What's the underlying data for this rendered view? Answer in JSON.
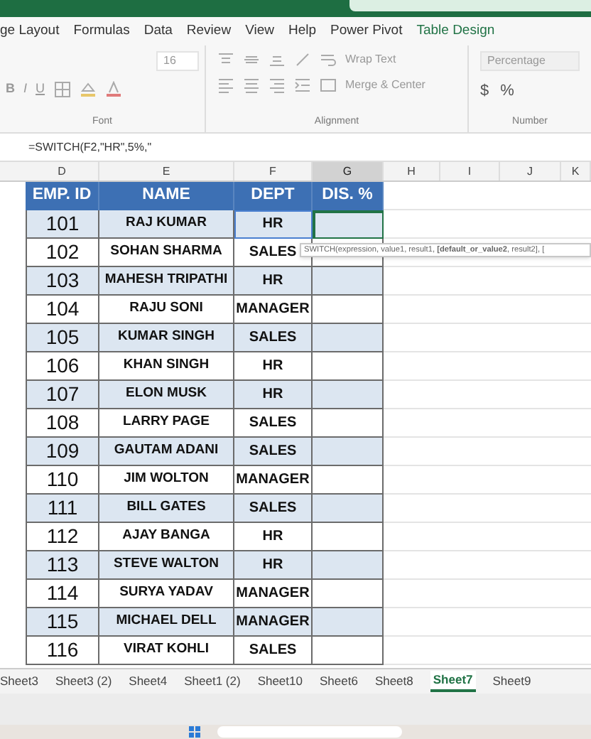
{
  "menu_tabs": [
    {
      "label": "ge Layout",
      "kind": "normal"
    },
    {
      "label": "Formulas",
      "kind": "normal"
    },
    {
      "label": "Data",
      "kind": "normal"
    },
    {
      "label": "Review",
      "kind": "normal"
    },
    {
      "label": "View",
      "kind": "normal"
    },
    {
      "label": "Help",
      "kind": "normal"
    },
    {
      "label": "Power Pivot",
      "kind": "normal"
    },
    {
      "label": "Table Design",
      "kind": "contextual"
    }
  ],
  "ribbon": {
    "font_size": "16",
    "wrap_text": "Wrap Text",
    "merge": "Merge & Center",
    "number_format": "Percentage",
    "currency": "$",
    "percent": "%",
    "bold": "B",
    "italic": "I",
    "underline": "U",
    "groups": [
      "Font",
      "Alignment",
      "Number"
    ]
  },
  "formula": "=SWITCH(F2,\"HR\",5%,\"",
  "columns": [
    {
      "label": "D",
      "selected": false
    },
    {
      "label": "E",
      "selected": false
    },
    {
      "label": "F",
      "selected": false
    },
    {
      "label": "G",
      "selected": true
    },
    {
      "label": "H",
      "selected": false
    },
    {
      "label": "I",
      "selected": false
    },
    {
      "label": "J",
      "selected": false
    },
    {
      "label": "K",
      "selected": false
    }
  ],
  "table": {
    "headers": [
      "EMP. ID",
      "NAME",
      "DEPT",
      "DIS. %"
    ],
    "rows": [
      {
        "id": "101",
        "name": "RAJ KUMAR",
        "dept": "HR",
        "selected": true
      },
      {
        "id": "102",
        "name": "SOHAN SHARMA",
        "dept": "SALES",
        "selected": false
      },
      {
        "id": "103",
        "name": "MAHESH TRIPATHI",
        "dept": "HR",
        "selected": false
      },
      {
        "id": "104",
        "name": "RAJU SONI",
        "dept": "MANAGER",
        "selected": false
      },
      {
        "id": "105",
        "name": "KUMAR SINGH",
        "dept": "SALES",
        "selected": false
      },
      {
        "id": "106",
        "name": "KHAN SINGH",
        "dept": "HR",
        "selected": false
      },
      {
        "id": "107",
        "name": "ELON MUSK",
        "dept": "HR",
        "selected": false
      },
      {
        "id": "108",
        "name": "LARRY PAGE",
        "dept": "SALES",
        "selected": false
      },
      {
        "id": "109",
        "name": "GAUTAM ADANI",
        "dept": "SALES",
        "selected": false
      },
      {
        "id": "110",
        "name": "JIM WOLTON",
        "dept": "MANAGER",
        "selected": false
      },
      {
        "id": "111",
        "name": "BILL GATES",
        "dept": "SALES",
        "selected": false
      },
      {
        "id": "112",
        "name": "AJAY BANGA",
        "dept": "HR",
        "selected": false
      },
      {
        "id": "113",
        "name": "STEVE WALTON",
        "dept": "HR",
        "selected": false
      },
      {
        "id": "114",
        "name": "SURYA YADAV",
        "dept": "MANAGER",
        "selected": false
      },
      {
        "id": "115",
        "name": "MICHAEL DELL",
        "dept": "MANAGER",
        "selected": false
      },
      {
        "id": "116",
        "name": "VIRAT KOHLI",
        "dept": "SALES",
        "selected": false
      }
    ]
  },
  "tooltip": "SWITCH(expression, value1, result1, **[default_or_value2**, result2], [",
  "sheet_tabs": [
    {
      "label": "Sheet3",
      "selected": false
    },
    {
      "label": "Sheet3 (2)",
      "selected": false
    },
    {
      "label": "Sheet4",
      "selected": false
    },
    {
      "label": "Sheet1 (2)",
      "selected": false
    },
    {
      "label": "Sheet10",
      "selected": false
    },
    {
      "label": "Sheet6",
      "selected": false
    },
    {
      "label": "Sheet8",
      "selected": false
    },
    {
      "label": "Sheet7",
      "selected": true
    },
    {
      "label": "Sheet9",
      "selected": false
    }
  ]
}
